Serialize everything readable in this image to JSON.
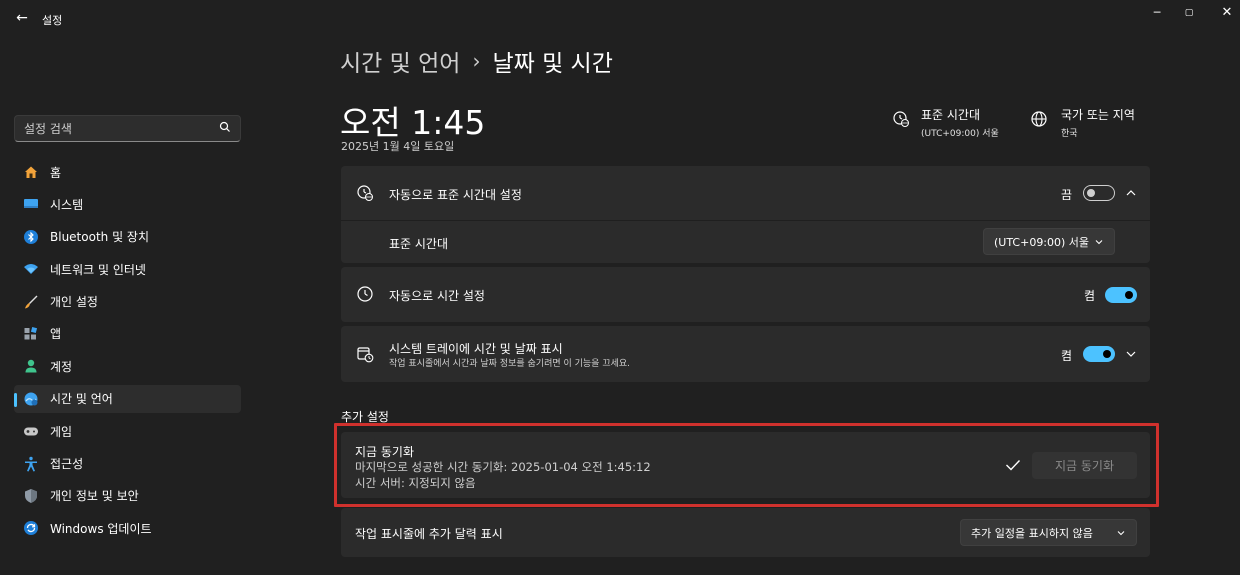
{
  "window": {
    "back_glyph": "←",
    "title": "설정",
    "minimize_glyph": "─",
    "maximize_glyph": "▢",
    "close_glyph": "✕"
  },
  "search": {
    "placeholder": "설정 검색"
  },
  "sidebar": {
    "items": [
      {
        "label": "홈",
        "icon": "home-icon"
      },
      {
        "label": "시스템",
        "icon": "monitor-icon"
      },
      {
        "label": "Bluetooth 및 장치",
        "icon": "bluetooth-icon"
      },
      {
        "label": "네트워크 및 인터넷",
        "icon": "wifi-icon"
      },
      {
        "label": "개인 설정",
        "icon": "brush-icon"
      },
      {
        "label": "앱",
        "icon": "apps-icon"
      },
      {
        "label": "계정",
        "icon": "person-icon"
      },
      {
        "label": "시간 및 언어",
        "icon": "time-language-icon",
        "active": true
      },
      {
        "label": "게임",
        "icon": "gamepad-icon"
      },
      {
        "label": "접근성",
        "icon": "accessibility-icon"
      },
      {
        "label": "개인 정보 및 보안",
        "icon": "shield-icon"
      },
      {
        "label": "Windows 업데이트",
        "icon": "update-icon"
      }
    ]
  },
  "header": {
    "parent": "시간 및 언어",
    "separator": "›",
    "title": "날짜 및 시간",
    "clock": "오전 1:45",
    "date": "2025년 1월 4일 토요일",
    "timezone_title": "표준 시간대",
    "timezone_value": "(UTC+09:00) 서울",
    "region_title": "국가 또는 지역",
    "region_value": "한국"
  },
  "settings": {
    "auto_timezone": {
      "label": "자동으로 표준 시간대 설정",
      "state_text": "끔",
      "on": false
    },
    "timezone_select": {
      "label": "표준 시간대",
      "value": "(UTC+09:00) 서울"
    },
    "auto_time": {
      "label": "자동으로 시간 설정",
      "state_text": "켬",
      "on": true
    },
    "tray_time": {
      "label": "시스템 트레이에 시간 및 날짜 표시",
      "desc": "작업 표시줄에서 시간과 날짜 정보를 숨기려면 이 기능을 끄세요.",
      "state_text": "켬",
      "on": true
    }
  },
  "additional": {
    "section_title": "추가 설정",
    "sync_title": "지금 동기화",
    "sync_last": "마지막으로 성공한 시간 동기화: 2025-01-04 오전 1:45:12",
    "sync_server": "시간 서버: 지정되지 않음",
    "sync_button": "지금 동기화",
    "calendar_label": "작업 표시줄에 추가 달력 표시",
    "calendar_value": "추가 일정을 표시하지 않음"
  },
  "colors": {
    "accent": "#4cc2ff",
    "highlight": "#d0312d",
    "background": "#202020",
    "card": "#2b2b2b"
  }
}
